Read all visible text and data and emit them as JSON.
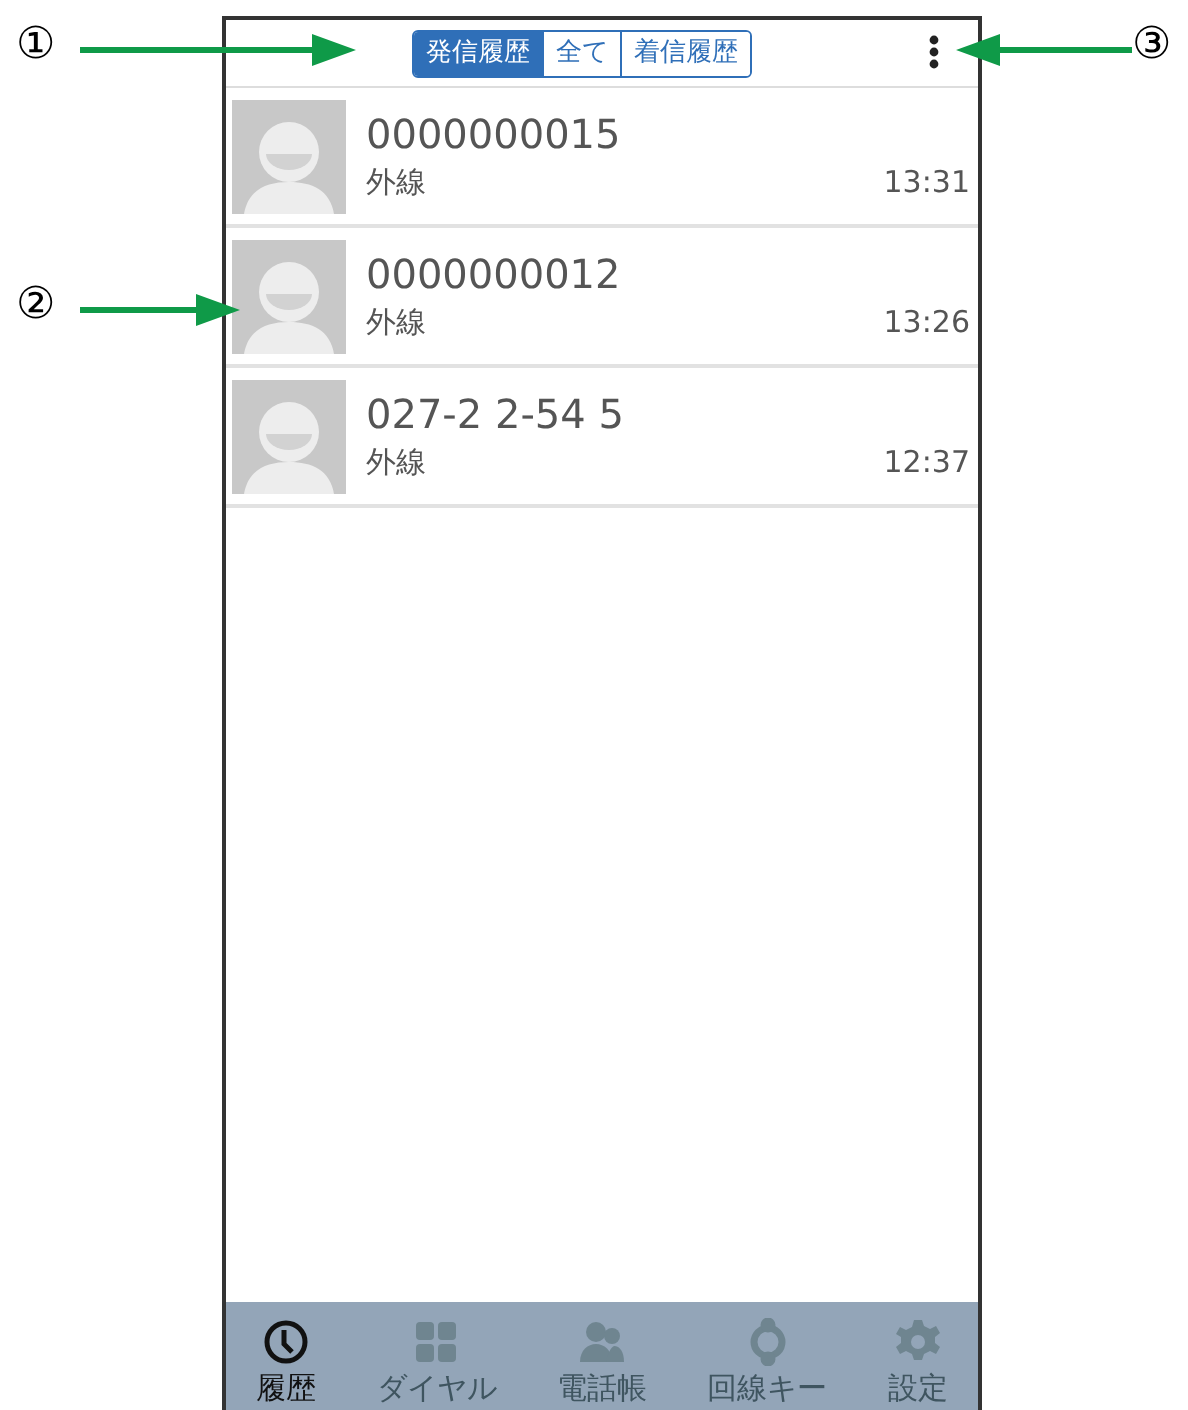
{
  "callouts": [
    {
      "label": "①"
    },
    {
      "label": "②"
    },
    {
      "label": "③"
    }
  ],
  "tabs": [
    {
      "label": "発信履歴",
      "selected": true
    },
    {
      "label": "全て",
      "selected": false
    },
    {
      "label": "着信履歴",
      "selected": false
    }
  ],
  "calls": [
    {
      "number": "0000000015",
      "line": "外線",
      "time": "13:31"
    },
    {
      "number": "0000000012",
      "line": "外線",
      "time": "13:26"
    },
    {
      "number": "027-2 2-54 5",
      "line": "外線",
      "time": "12:37"
    }
  ],
  "nav": [
    {
      "kind": "clock",
      "label": "履歴",
      "selected": true
    },
    {
      "kind": "dial",
      "label": "ダイヤル",
      "selected": false
    },
    {
      "kind": "contacts",
      "label": "電話帳",
      "selected": false
    },
    {
      "kind": "line",
      "label": "回線キー",
      "selected": false
    },
    {
      "kind": "settings",
      "label": "設定",
      "selected": false
    }
  ]
}
